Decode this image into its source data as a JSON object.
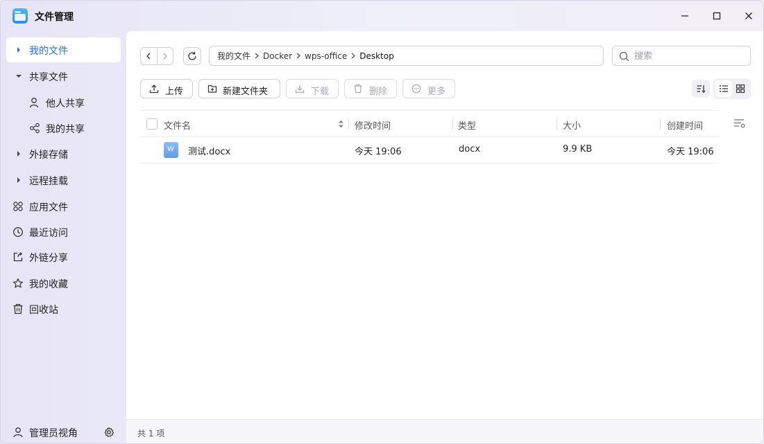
{
  "window": {
    "title": "文件管理"
  },
  "sidebar": {
    "items": [
      {
        "label": "我的文件"
      },
      {
        "label": "共享文件"
      },
      {
        "label": "他人共享"
      },
      {
        "label": "我的共享"
      },
      {
        "label": "外接存储"
      },
      {
        "label": "远程挂载"
      },
      {
        "label": "应用文件"
      },
      {
        "label": "最近访问"
      },
      {
        "label": "外链分享"
      },
      {
        "label": "我的收藏"
      },
      {
        "label": "回收站"
      }
    ],
    "footer_label": "管理员视角"
  },
  "breadcrumb": [
    "我的文件",
    "Docker",
    "wps-office",
    "Desktop"
  ],
  "search": {
    "placeholder": "搜索"
  },
  "toolbar": {
    "upload": "上传",
    "new_folder": "新建文件夹",
    "download": "下载",
    "delete": "删除",
    "more": "更多"
  },
  "table": {
    "columns": [
      "文件名",
      "修改时间",
      "类型",
      "大小",
      "创建时间"
    ],
    "rows": [
      {
        "name": "测试.docx",
        "modified": "今天 19:06",
        "type": "docx",
        "size": "9.9 KB",
        "created": "今天 19:06"
      }
    ]
  },
  "status": {
    "count_text": "共 1 项"
  },
  "colors": {
    "accent": "#2d6fd6"
  }
}
